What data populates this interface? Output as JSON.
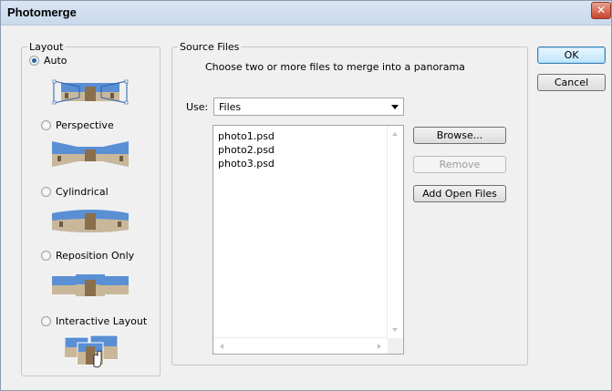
{
  "window": {
    "title": "Photomerge",
    "close_label": "✕"
  },
  "layout": {
    "legend": "Layout",
    "options": [
      {
        "label": "Auto",
        "selected": true
      },
      {
        "label": "Perspective",
        "selected": false
      },
      {
        "label": "Cylindrical",
        "selected": false
      },
      {
        "label": "Reposition Only",
        "selected": false
      },
      {
        "label": "Interactive Layout",
        "selected": false
      }
    ]
  },
  "source": {
    "legend": "Source Files",
    "hint": "Choose two or more files to merge into a panorama",
    "use_label": "Use:",
    "use_value": "Files",
    "files": [
      "photo1.psd",
      "photo2.psd",
      "photo3.psd"
    ]
  },
  "buttons": {
    "browse": "Browse...",
    "remove": "Remove",
    "add_open": "Add Open Files",
    "ok": "OK",
    "cancel": "Cancel"
  },
  "colors": {
    "accent": "#27629e",
    "sky": "#5a8fd4",
    "building": "#c9b79a"
  }
}
